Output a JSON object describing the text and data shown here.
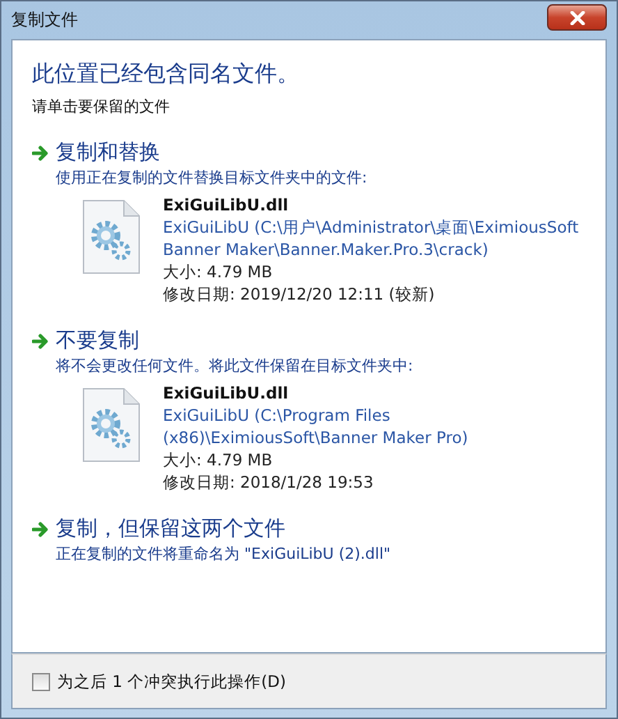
{
  "window": {
    "title": "复制文件"
  },
  "heading": "此位置已经包含同名文件。",
  "subheading": "请单击要保留的文件",
  "options": [
    {
      "title": "复制和替换",
      "description": "使用正在复制的文件替换目标文件夹中的文件:",
      "file": {
        "name": "ExiGuiLibU.dll",
        "path": "ExiGuiLibU (C:\\用户\\Administrator\\桌面\\EximiousSoft Banner Maker\\Banner.Maker.Pro.3\\crack)",
        "size": "大小: 4.79 MB",
        "modified": "修改日期: 2019/12/20 12:11 (较新)"
      }
    },
    {
      "title": "不要复制",
      "description": "将不会更改任何文件。将此文件保留在目标文件夹中:",
      "file": {
        "name": "ExiGuiLibU.dll",
        "path": "ExiGuiLibU (C:\\Program Files (x86)\\EximiousSoft\\Banner Maker Pro)",
        "size": "大小: 4.79 MB",
        "modified": "修改日期: 2018/1/28 19:53"
      }
    },
    {
      "title": "复制，但保留这两个文件",
      "description": "正在复制的文件将重命名为 \"ExiGuiLibU (2).dll\""
    }
  ],
  "footer": {
    "checkbox": {
      "label": "为之后 1 个冲突执行此操作(D)",
      "checked": false
    }
  }
}
